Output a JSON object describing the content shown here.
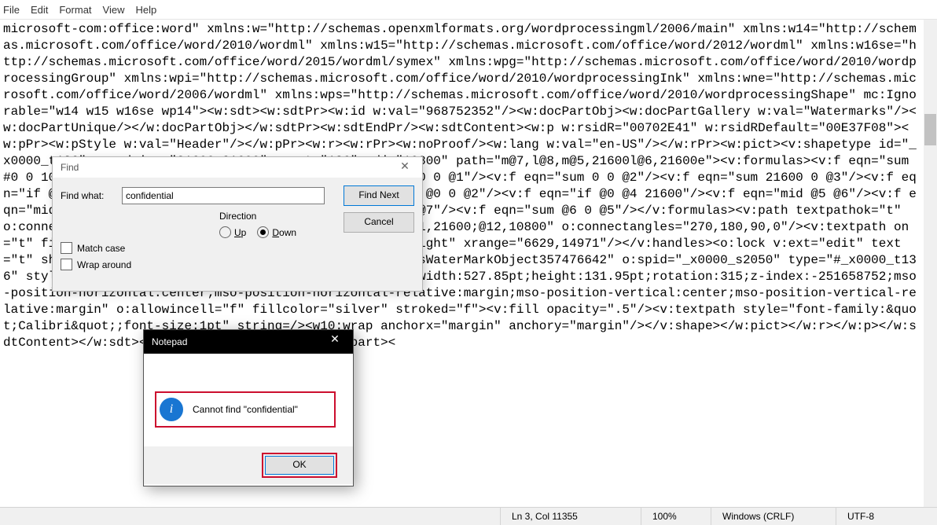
{
  "menubar": {
    "file": "File",
    "edit": "Edit",
    "format": "Format",
    "view": "View",
    "help": "Help"
  },
  "editor": {
    "content": "microsoft-com:office:word\" xmlns:w=\"http://schemas.openxmlformats.org/wordprocessingml/2006/main\" xmlns:w14=\"http://schemas.microsoft.com/office/word/2010/wordml\" xmlns:w15=\"http://schemas.microsoft.com/office/word/2012/wordml\" xmlns:w16se=\"http://schemas.microsoft.com/office/word/2015/wordml/symex\" xmlns:wpg=\"http://schemas.microsoft.com/office/word/2010/wordprocessingGroup\" xmlns:wpi=\"http://schemas.microsoft.com/office/word/2010/wordprocessingInk\" xmlns:wne=\"http://schemas.microsoft.com/office/word/2006/wordml\" xmlns:wps=\"http://schemas.microsoft.com/office/word/2010/wordprocessingShape\" mc:Ignorable=\"w14 w15 w16se wp14\"><w:sdt><w:sdtPr><w:id w:val=\"968752352\"/><w:docPartObj><w:docPartGallery w:val=\"Watermarks\"/><w:docPartUnique/></w:docPartObj></w:sdtPr><w:sdtEndPr/><w:sdtContent><w:p w:rsidR=\"00702E41\" w:rsidRDefault=\"00E37F08\"><w:pPr><w:pStyle w:val=\"Header\"/></w:pPr><w:r><w:rPr><w:noProof/><w:lang w:val=\"en-US\"/></w:rPr><w:pict><v:shapetype id=\"_x0000_t136\" coordsize=\"21600,21600\" o:spt=\"136\" adj=\"10800\" path=\"m@7,l@8,m@5,21600l@6,21600e\"><v:formulas><v:f eqn=\"sum #0 0 10800\"/><v:f eqn=\"prod #0 2 1\"/><v:f eqn=\"sum 21600 0 @1\"/><v:f eqn=\"sum 0 0 @2\"/><v:f eqn=\"sum 21600 0 @3\"/><v:f eqn=\"if @0 @3 0\"/><v:f eqn=\"if @0 21600 @1\"/><v:f eqn=\"if @0 0 @2\"/><v:f eqn=\"if @0 @4 21600\"/><v:f eqn=\"mid @5 @6\"/><v:f eqn=\"mid @8 @5\"/><v:f eqn=\"mid @7 @8\"/><v:f eqn=\"mid @6 @7\"/><v:f eqn=\"sum @6 0 @5\"/></v:formulas><v:path textpathok=\"t\" o:connecttype=\"custom\" o:connectlocs=\"@9,0;@10,10800;@11,21600;@12,10800\" o:connectangles=\"270,180,90,0\"/><v:textpath on=\"t\" fitshape=\"t\"/><v:handles><v:h position=\"#0,bottomRight\" xrange=\"6629,14971\"/></v:handles><o:lock v:ext=\"edit\" text=\"t\" shapetype=\"t\"/></v:shapetype><v:shape id=\"PowerPlusWaterMarkObject357476642\" o:spid=\"_x0000_s2050\" type=\"#_x0000_t136\" style=\"position:absolute;margin-left:0;margin-top:0;width:527.85pt;height:131.95pt;rotation:315;z-index:-251658752;mso-position-horizontal:center;mso-position-horizontal-relative:margin;mso-position-vertical:center;mso-position-vertical-relative:margin\" o:allowincell=\"f\" fillcolor=\"silver\" stroked=\"f\"><v:fill opacity=\".5\"/><v:textpath style=\"font-family:&quot;Calibri&quot;;font-size:1pt\" string=/><w10:wrap anchorx=\"margin\" anchory=\"margin\"/></v:shape></w:pict></w:r></w:p></w:sdtContent></w:sdt></w:hdr></pkg:xmlData></pkg:part><"
  },
  "find": {
    "title": "Find",
    "what_label": "Find what:",
    "what_value": "confidential",
    "find_next": "Find Next",
    "cancel": "Cancel",
    "direction_label": "Direction",
    "up": "Up",
    "down": "Down",
    "down_selected": true,
    "match_case": "Match case",
    "wrap_around": "Wrap around"
  },
  "alert": {
    "title": "Notepad",
    "message": "Cannot find \"confidential\"",
    "ok": "OK"
  },
  "status": {
    "pos": "Ln 3, Col 11355",
    "zoom": "100%",
    "eol": "Windows (CRLF)",
    "encoding": "UTF-8"
  }
}
